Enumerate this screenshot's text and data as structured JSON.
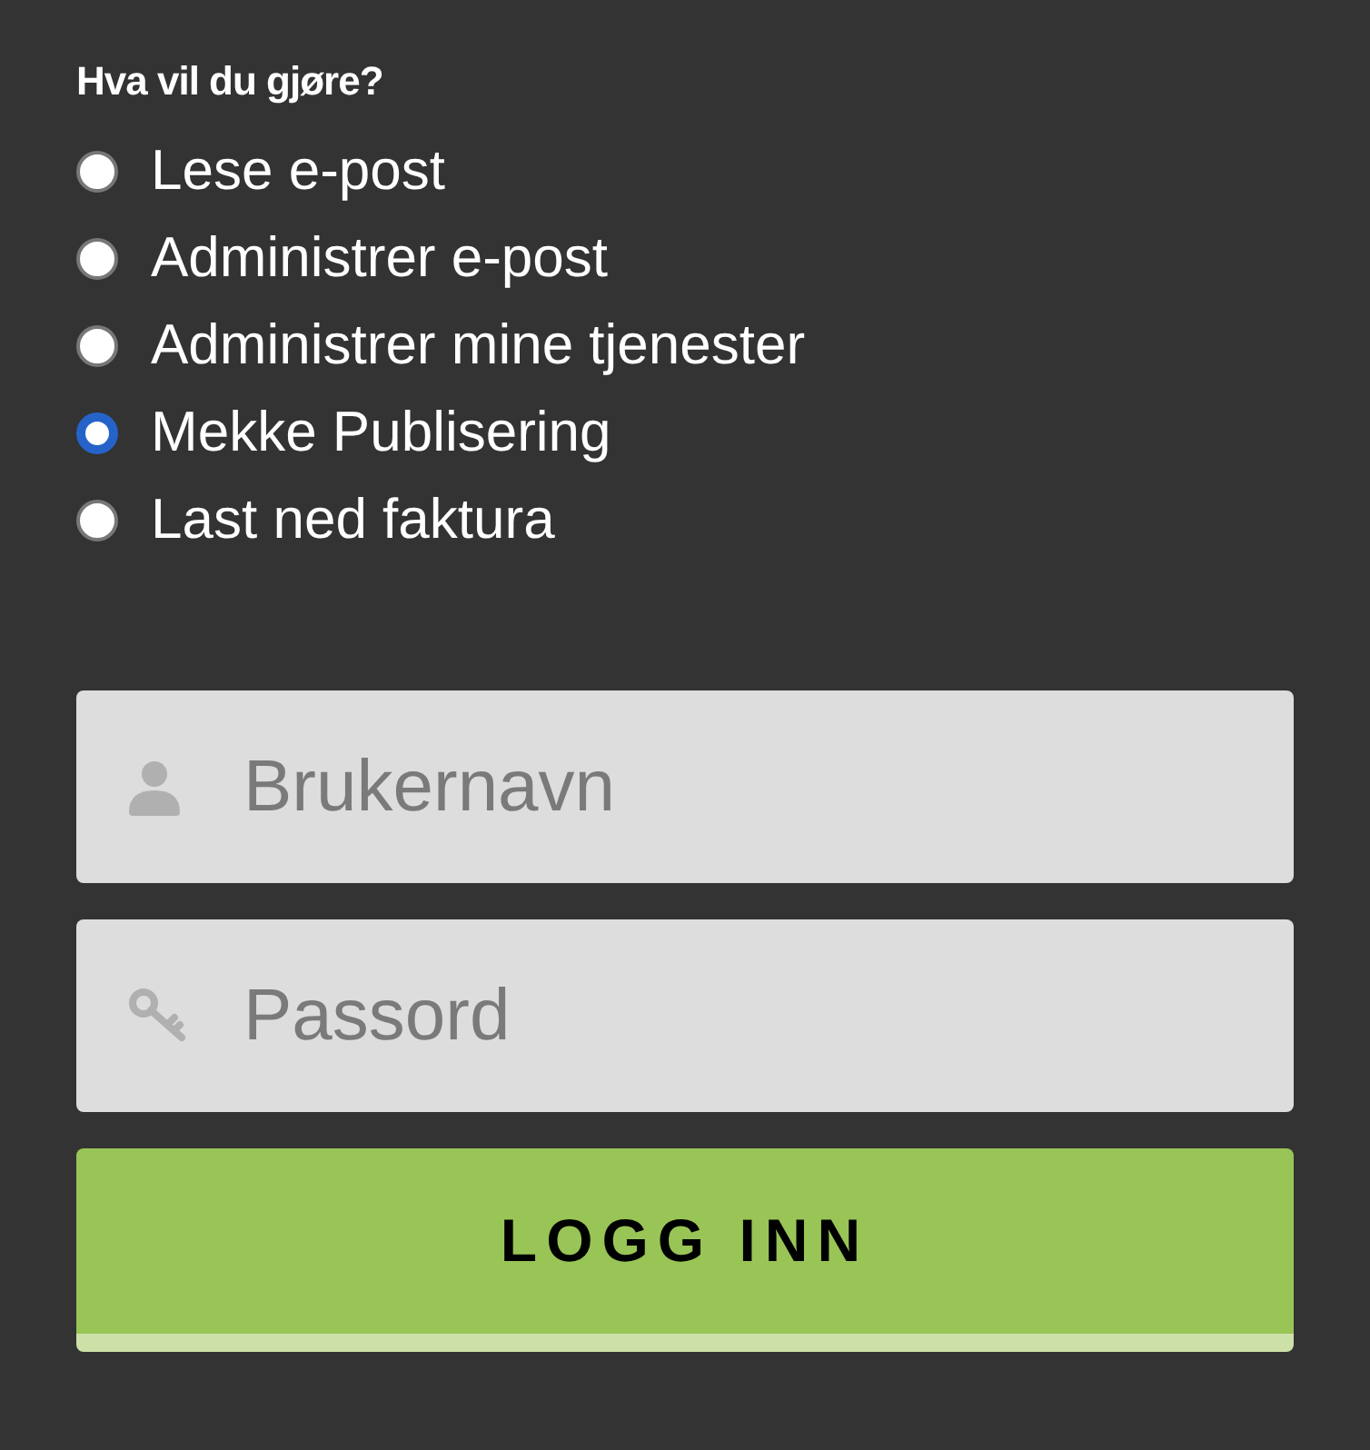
{
  "heading": "Hva vil du gjøre?",
  "options": [
    {
      "label": "Lese e-post",
      "selected": false
    },
    {
      "label": "Administrer e-post",
      "selected": false
    },
    {
      "label": "Administrer mine tjenester",
      "selected": false
    },
    {
      "label": "Mekke Publisering",
      "selected": true
    },
    {
      "label": "Last ned faktura",
      "selected": false
    }
  ],
  "fields": [
    {
      "kind": "username",
      "placeholder": "Brukernavn"
    },
    {
      "kind": "password",
      "placeholder": "Passord"
    }
  ],
  "button": "LOGG INN"
}
